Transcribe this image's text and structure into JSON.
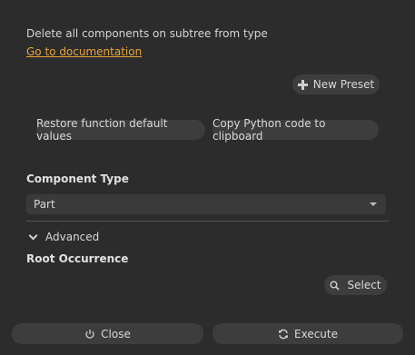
{
  "header": {
    "description": "Delete all components on subtree from type",
    "doc_link": "Go to documentation"
  },
  "toolbar": {
    "new_preset_label": "New Preset",
    "restore_label": "Restore function default values",
    "copy_label": "Copy Python code to clipboard"
  },
  "form": {
    "component_type_label": "Component Type",
    "component_type_value": "Part",
    "advanced_label": "Advanced",
    "root_occurrence_label": "Root Occurrence",
    "select_label": "Select"
  },
  "footer": {
    "close_label": "Close",
    "execute_label": "Execute"
  },
  "colors": {
    "background": "#2c2c2c",
    "button": "#3d3d3d",
    "link": "#e8a33c"
  },
  "icons": {
    "new_preset": "plus-icon",
    "dropdown": "chevron-down-icon",
    "advanced": "chevron-down-icon",
    "select": "search-icon",
    "close": "power-icon",
    "execute": "refresh-icon"
  }
}
